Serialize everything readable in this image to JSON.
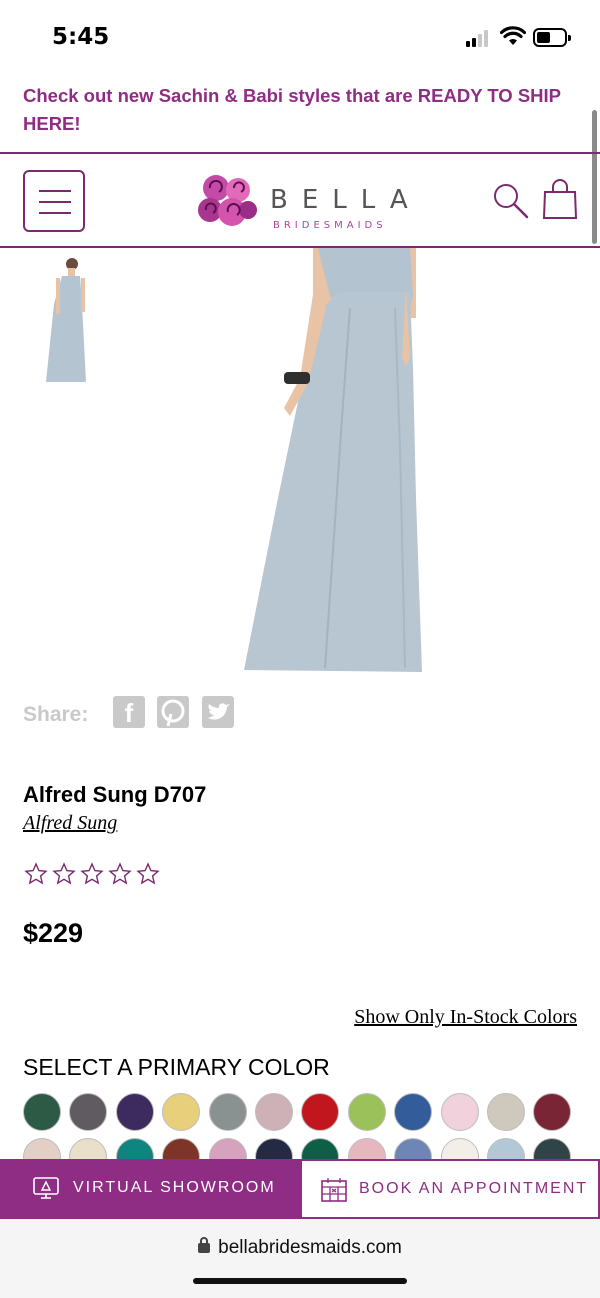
{
  "status_bar": {
    "time": "5:45"
  },
  "promo": {
    "text": "Check out new Sachin & Babi styles that are READY TO SHIP HERE!"
  },
  "header": {
    "logo_word": "BELLA",
    "logo_sub": "BRIDESMAIDS",
    "menu_icon": "hamburger-icon",
    "search_icon": "search-icon",
    "bag_icon": "shopping-bag-icon",
    "accent_color": "#8e2d83"
  },
  "share": {
    "label": "Share:",
    "icons": [
      "facebook-icon",
      "pinterest-icon",
      "twitter-icon"
    ]
  },
  "product": {
    "name": "Alfred Sung D707",
    "brand": "Alfred Sung",
    "rating": 0,
    "rating_max": 5,
    "price": "$229"
  },
  "colors": {
    "instock_link": "Show Only In-Stock Colors",
    "title": "SELECT A PRIMARY COLOR",
    "row1": [
      "#2d5a45",
      "#5f5b61",
      "#3d2a5e",
      "#e8cf7c",
      "#8a9191",
      "#cdb1b7",
      "#c2161f",
      "#9bc15a",
      "#335d9a",
      "#f1d2dc",
      "#cfc8bc",
      "#7a2535"
    ],
    "row2": [
      "#e3cfc6",
      "#e9dfcb",
      "#0f857f",
      "#7e3527",
      "#d6a2bd",
      "#232a44",
      "#0d5f45",
      "#e7b7bf",
      "#6e86b5",
      "#f3efe8",
      "#b3c8d6",
      "#2e4446"
    ]
  },
  "actions": {
    "showroom": "VIRTUAL SHOWROOM",
    "appointment": "BOOK AN APPOINTMENT"
  },
  "browser": {
    "url": "bellabridesmaids.com"
  }
}
